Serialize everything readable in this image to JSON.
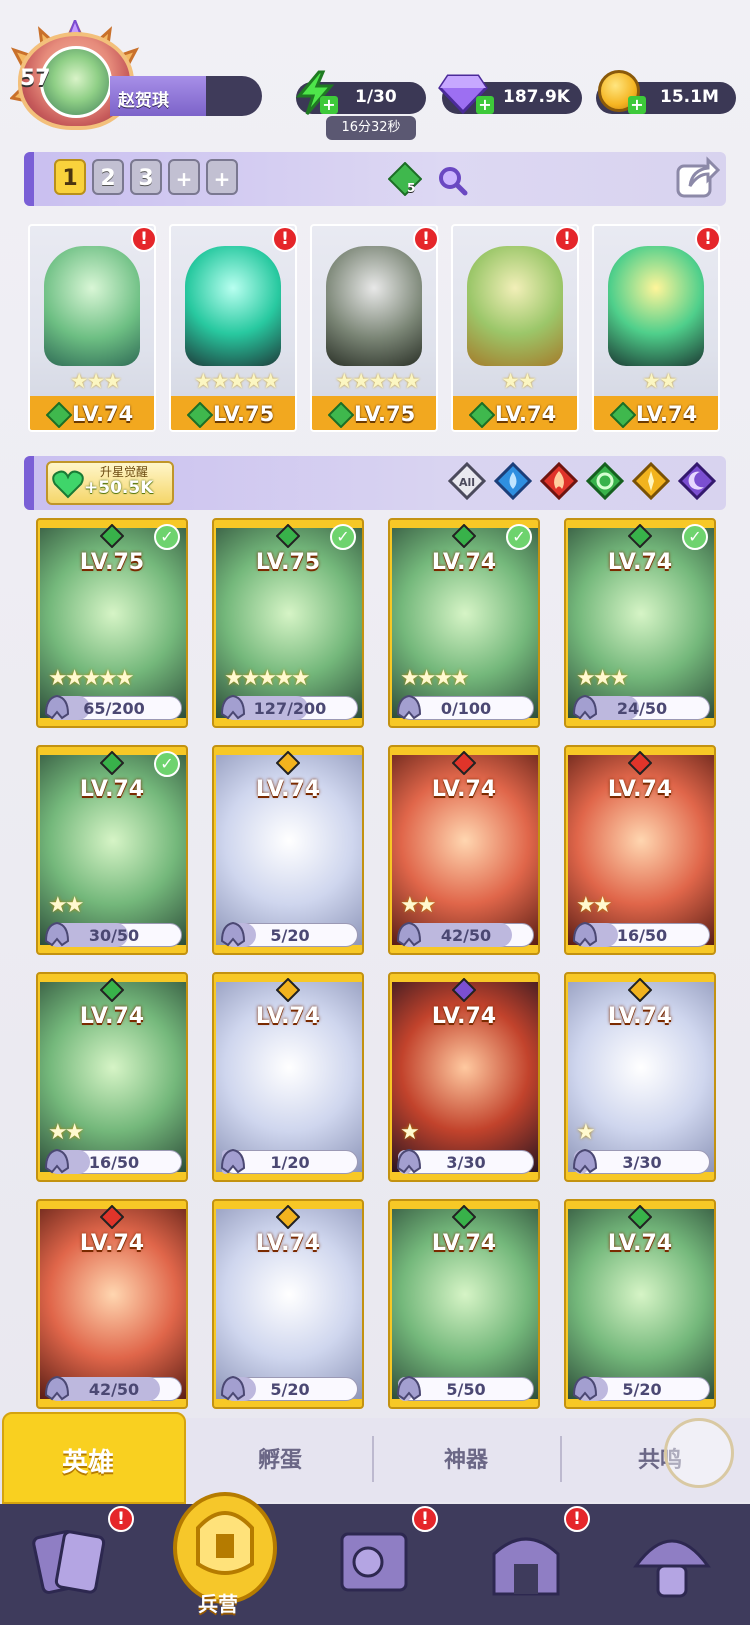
{
  "player": {
    "level": "57",
    "name": "赵贺琪"
  },
  "resources": {
    "energy": "1/30",
    "energy_timer": "16分32秒",
    "gems": "187.9K",
    "gold": "15.1M"
  },
  "team_bar": {
    "slots": [
      "1",
      "2",
      "3",
      "+",
      "+"
    ],
    "element_gem_count": "5"
  },
  "team": [
    {
      "level": "LV.74",
      "stars": "★★★"
    },
    {
      "level": "LV.75",
      "stars": "★★★★★"
    },
    {
      "level": "LV.75",
      "stars": "★★★★★"
    },
    {
      "level": "LV.74",
      "stars": "★★"
    },
    {
      "level": "LV.74",
      "stars": "★★"
    }
  ],
  "awaken": {
    "title": "升星觉醒",
    "value": "+50.5K"
  },
  "filters": [
    "All",
    "water",
    "fire",
    "nature",
    "light",
    "dark"
  ],
  "heroes": [
    {
      "level": "LV.75",
      "progress": "65/200",
      "pct": 32,
      "stars": "★★★★★",
      "element": "nature",
      "check": true
    },
    {
      "level": "LV.75",
      "progress": "127/200",
      "pct": 63,
      "stars": "★★★★★",
      "element": "nature",
      "check": true
    },
    {
      "level": "LV.74",
      "progress": "0/100",
      "pct": 0,
      "stars": "★★★★",
      "element": "nature",
      "check": true
    },
    {
      "level": "LV.74",
      "progress": "24/50",
      "pct": 48,
      "stars": "★★★",
      "element": "nature",
      "check": true
    },
    {
      "level": "LV.74",
      "progress": "30/50",
      "pct": 60,
      "stars": "★★",
      "element": "nature",
      "check": true
    },
    {
      "level": "LV.74",
      "progress": "5/20",
      "pct": 25,
      "stars": "",
      "element": "light",
      "check": false
    },
    {
      "level": "LV.74",
      "progress": "42/50",
      "pct": 84,
      "stars": "★★",
      "element": "fire",
      "check": false
    },
    {
      "level": "LV.74",
      "progress": "16/50",
      "pct": 32,
      "stars": "★★",
      "element": "fire",
      "check": false
    },
    {
      "level": "LV.74",
      "progress": "16/50",
      "pct": 32,
      "stars": "★★",
      "element": "nature",
      "check": false
    },
    {
      "level": "LV.74",
      "progress": "1/20",
      "pct": 5,
      "stars": "",
      "element": "light",
      "check": false
    },
    {
      "level": "LV.74",
      "progress": "3/30",
      "pct": 10,
      "stars": "★",
      "element": "dark",
      "check": false
    },
    {
      "level": "LV.74",
      "progress": "3/30",
      "pct": 10,
      "stars": "★",
      "element": "light",
      "check": false
    },
    {
      "level": "LV.74",
      "progress": "42/50",
      "pct": 84,
      "stars": "",
      "element": "fire",
      "check": false
    },
    {
      "level": "LV.74",
      "progress": "5/20",
      "pct": 25,
      "stars": "",
      "element": "light",
      "check": false
    },
    {
      "level": "LV.74",
      "progress": "5/50",
      "pct": 10,
      "stars": "",
      "element": "nature",
      "check": false
    },
    {
      "level": "LV.74",
      "progress": "5/20",
      "pct": 25,
      "stars": "",
      "element": "nature",
      "check": false
    }
  ],
  "tabs": {
    "heroes": "英雄",
    "hatch": "孵蛋",
    "artifacts": "神器",
    "resonance": "共鸣"
  },
  "bottom_nav": {
    "barracks": "兵营"
  },
  "colors": {
    "gold": "#f7c826",
    "purple": "#7a5fd6",
    "nature": "#38b24a",
    "fire": "#e0342a",
    "water": "#2f8fe0",
    "light": "#f2b31e",
    "dark": "#7b4fd1"
  }
}
